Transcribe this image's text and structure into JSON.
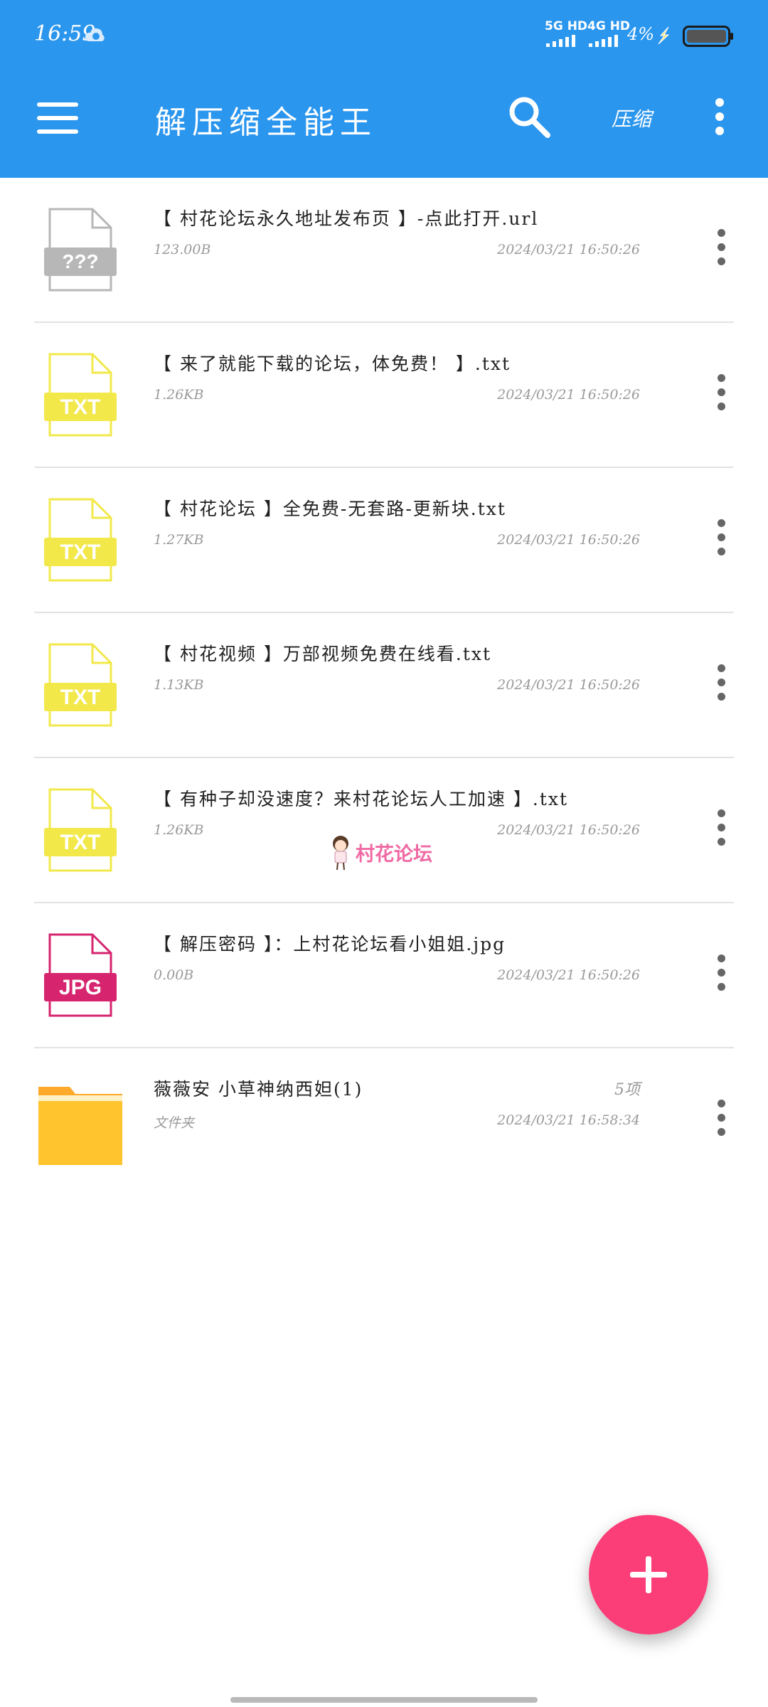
{
  "status_bar": {
    "time": "16:59",
    "network1": "5G HD",
    "network2": "4G HD",
    "battery_percent": "4%"
  },
  "app_bar": {
    "title": "解压缩全能王",
    "compress_label": "压缩"
  },
  "files": [
    {
      "name": "【 村花论坛永久地址发布页 】-点此打开.url",
      "size": "123.00B",
      "date": "2024/03/21 16:50:26",
      "icon": "???",
      "icon_color": "#b7b7b7",
      "type": "unknown"
    },
    {
      "name": "【 来了就能下载的论坛，体免费！ 】.txt",
      "size": "1.26KB",
      "date": "2024/03/21 16:50:26",
      "icon": "TXT",
      "icon_color": "#f2e84a",
      "type": "txt"
    },
    {
      "name": "【 村花论坛 】全免费-无套路-更新块.txt",
      "size": "1.27KB",
      "date": "2024/03/21 16:50:26",
      "icon": "TXT",
      "icon_color": "#f2e84a",
      "type": "txt"
    },
    {
      "name": "【 村花视频 】万部视频免费在线看.txt",
      "size": "1.13KB",
      "date": "2024/03/21 16:50:26",
      "icon": "TXT",
      "icon_color": "#f2e84a",
      "type": "txt"
    },
    {
      "name": "【 有种子却没速度？来村花论坛人工加速 】.txt",
      "size": "1.26KB",
      "date": "2024/03/21 16:50:26",
      "icon": "TXT",
      "icon_color": "#f2e84a",
      "type": "txt"
    },
    {
      "name": "【 解压密码 】：上村花论坛看小姐姐.jpg",
      "size": "0.00B",
      "date": "2024/03/21 16:50:26",
      "icon": "JPG",
      "icon_color": "#d6246e",
      "type": "jpg"
    },
    {
      "name": "薇薇安 小草神纳西妲(1)",
      "size": "文件夹",
      "date": "2024/03/21 16:58:34",
      "count": "5项",
      "icon": "folder-icon",
      "icon_color": "#ffc12f",
      "type": "folder"
    }
  ],
  "watermark": {
    "text": "村花论坛"
  },
  "fab": {
    "icon": "plus-icon",
    "color": "#fb3d78"
  },
  "colors": {
    "app_bar": "#2b96ee",
    "divider": "#e2e2e2"
  }
}
